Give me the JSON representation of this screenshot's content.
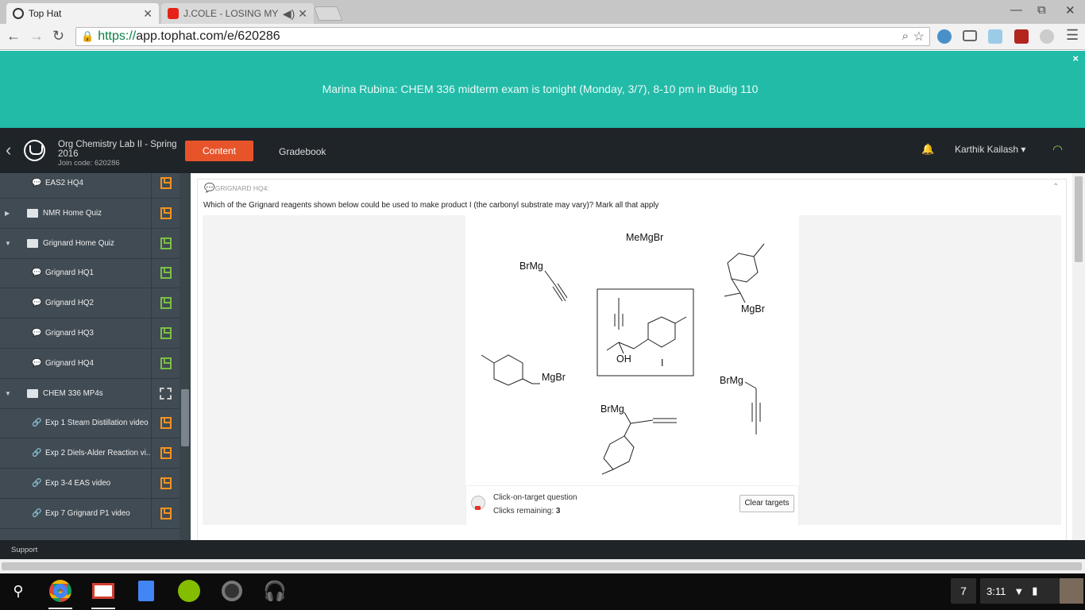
{
  "browser": {
    "tabs": [
      {
        "title": "Top Hat",
        "close": "✕"
      },
      {
        "title": "J.COLE - LOSING MY B/",
        "close": "✕"
      }
    ],
    "window_controls": {
      "minimize": "—",
      "restore": "⧉",
      "close": "✕"
    },
    "url_scheme": "https://",
    "url_rest": "app.tophat.com/e/620286"
  },
  "banner": {
    "message": "Marina Rubina: CHEM 336 midterm exam is tonight (Monday, 3/7), 8-10 pm in Budig 110",
    "close": "×"
  },
  "header": {
    "course_title": "Org Chemistry Lab II - Spring 2016",
    "join_code": "Join code: 620286",
    "nav": {
      "content": "Content",
      "gradebook": "Gradebook"
    },
    "user": "Karthik Kailash"
  },
  "sidebar": {
    "items": [
      {
        "label": "EAS2 HQ4",
        "kind": "question",
        "action": "orange"
      },
      {
        "label": "NMR Home Quiz",
        "kind": "folder",
        "caret": "▶",
        "action": "orange"
      },
      {
        "label": "Grignard Home Quiz",
        "kind": "folder",
        "caret": "▼",
        "action": "green"
      },
      {
        "label": "Grignard HQ1",
        "kind": "question",
        "action": "green"
      },
      {
        "label": "Grignard HQ2",
        "kind": "question",
        "action": "green"
      },
      {
        "label": "Grignard HQ3",
        "kind": "question",
        "action": "green"
      },
      {
        "label": "Grignard HQ4",
        "kind": "question",
        "action": "green"
      },
      {
        "label": "CHEM 336 MP4s",
        "kind": "folder",
        "caret": "▼",
        "action": "dashed"
      },
      {
        "label": "Exp 1 Steam Distillation video",
        "kind": "link",
        "action": "orange"
      },
      {
        "label": "Exp 2 Diels-Alder Reaction vi...",
        "kind": "link",
        "action": "orange"
      },
      {
        "label": "Exp 3-4 EAS video",
        "kind": "link",
        "action": "orange"
      },
      {
        "label": "Exp 7 Grignard P1 video",
        "kind": "link",
        "action": "orange"
      }
    ]
  },
  "question": {
    "tag": "GRIGNARD HQ4:",
    "prompt": "Which of the Grignard reagents shown below could be used to make product I (the carbonyl substrate may vary)? Mark all that apply",
    "type_label": "Click-on-target question",
    "clicks_label": "Clicks remaining:",
    "clicks_remaining": "3",
    "clear_button": "Clear targets",
    "image_labels": {
      "memgbr": "MeMgBr",
      "brmg_top_left": "BrMg",
      "mgbr_right": "MgBr",
      "oh": "OH",
      "product": "I",
      "mgbr_left": "MgBr",
      "brmg_right": "BrMg",
      "brmg_bottom": "BrMg"
    }
  },
  "footer": {
    "support": "Support"
  },
  "shelf": {
    "apps": [
      "search-icon",
      "chrome-icon",
      "gmail-icon",
      "docs-icon",
      "spotify-icon",
      "camera-icon",
      "music-icon"
    ],
    "notification_count": "7",
    "time": "3:11"
  },
  "colors": {
    "banner": "#22bba8",
    "header": "#1f2429",
    "sidebar": "#404b53",
    "content_button": "#e8542a",
    "action_orange": "#f5931f",
    "action_green": "#7cc043"
  }
}
